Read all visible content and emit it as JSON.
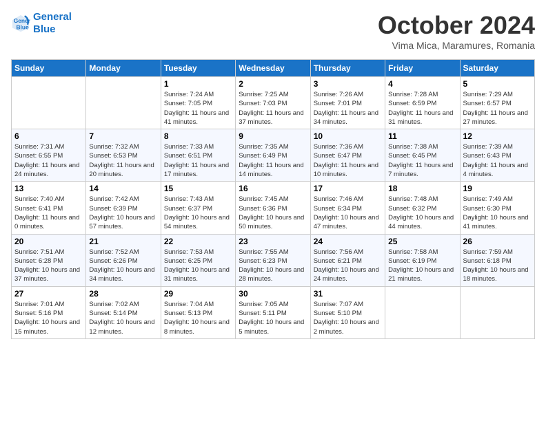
{
  "header": {
    "logo_line1": "General",
    "logo_line2": "Blue",
    "month": "October 2024",
    "location": "Vima Mica, Maramures, Romania"
  },
  "days_of_week": [
    "Sunday",
    "Monday",
    "Tuesday",
    "Wednesday",
    "Thursday",
    "Friday",
    "Saturday"
  ],
  "weeks": [
    [
      {
        "day": "",
        "info": ""
      },
      {
        "day": "",
        "info": ""
      },
      {
        "day": "1",
        "info": "Sunrise: 7:24 AM\nSunset: 7:05 PM\nDaylight: 11 hours and 41 minutes."
      },
      {
        "day": "2",
        "info": "Sunrise: 7:25 AM\nSunset: 7:03 PM\nDaylight: 11 hours and 37 minutes."
      },
      {
        "day": "3",
        "info": "Sunrise: 7:26 AM\nSunset: 7:01 PM\nDaylight: 11 hours and 34 minutes."
      },
      {
        "day": "4",
        "info": "Sunrise: 7:28 AM\nSunset: 6:59 PM\nDaylight: 11 hours and 31 minutes."
      },
      {
        "day": "5",
        "info": "Sunrise: 7:29 AM\nSunset: 6:57 PM\nDaylight: 11 hours and 27 minutes."
      }
    ],
    [
      {
        "day": "6",
        "info": "Sunrise: 7:31 AM\nSunset: 6:55 PM\nDaylight: 11 hours and 24 minutes."
      },
      {
        "day": "7",
        "info": "Sunrise: 7:32 AM\nSunset: 6:53 PM\nDaylight: 11 hours and 20 minutes."
      },
      {
        "day": "8",
        "info": "Sunrise: 7:33 AM\nSunset: 6:51 PM\nDaylight: 11 hours and 17 minutes."
      },
      {
        "day": "9",
        "info": "Sunrise: 7:35 AM\nSunset: 6:49 PM\nDaylight: 11 hours and 14 minutes."
      },
      {
        "day": "10",
        "info": "Sunrise: 7:36 AM\nSunset: 6:47 PM\nDaylight: 11 hours and 10 minutes."
      },
      {
        "day": "11",
        "info": "Sunrise: 7:38 AM\nSunset: 6:45 PM\nDaylight: 11 hours and 7 minutes."
      },
      {
        "day": "12",
        "info": "Sunrise: 7:39 AM\nSunset: 6:43 PM\nDaylight: 11 hours and 4 minutes."
      }
    ],
    [
      {
        "day": "13",
        "info": "Sunrise: 7:40 AM\nSunset: 6:41 PM\nDaylight: 11 hours and 0 minutes."
      },
      {
        "day": "14",
        "info": "Sunrise: 7:42 AM\nSunset: 6:39 PM\nDaylight: 10 hours and 57 minutes."
      },
      {
        "day": "15",
        "info": "Sunrise: 7:43 AM\nSunset: 6:37 PM\nDaylight: 10 hours and 54 minutes."
      },
      {
        "day": "16",
        "info": "Sunrise: 7:45 AM\nSunset: 6:36 PM\nDaylight: 10 hours and 50 minutes."
      },
      {
        "day": "17",
        "info": "Sunrise: 7:46 AM\nSunset: 6:34 PM\nDaylight: 10 hours and 47 minutes."
      },
      {
        "day": "18",
        "info": "Sunrise: 7:48 AM\nSunset: 6:32 PM\nDaylight: 10 hours and 44 minutes."
      },
      {
        "day": "19",
        "info": "Sunrise: 7:49 AM\nSunset: 6:30 PM\nDaylight: 10 hours and 41 minutes."
      }
    ],
    [
      {
        "day": "20",
        "info": "Sunrise: 7:51 AM\nSunset: 6:28 PM\nDaylight: 10 hours and 37 minutes."
      },
      {
        "day": "21",
        "info": "Sunrise: 7:52 AM\nSunset: 6:26 PM\nDaylight: 10 hours and 34 minutes."
      },
      {
        "day": "22",
        "info": "Sunrise: 7:53 AM\nSunset: 6:25 PM\nDaylight: 10 hours and 31 minutes."
      },
      {
        "day": "23",
        "info": "Sunrise: 7:55 AM\nSunset: 6:23 PM\nDaylight: 10 hours and 28 minutes."
      },
      {
        "day": "24",
        "info": "Sunrise: 7:56 AM\nSunset: 6:21 PM\nDaylight: 10 hours and 24 minutes."
      },
      {
        "day": "25",
        "info": "Sunrise: 7:58 AM\nSunset: 6:19 PM\nDaylight: 10 hours and 21 minutes."
      },
      {
        "day": "26",
        "info": "Sunrise: 7:59 AM\nSunset: 6:18 PM\nDaylight: 10 hours and 18 minutes."
      }
    ],
    [
      {
        "day": "27",
        "info": "Sunrise: 7:01 AM\nSunset: 5:16 PM\nDaylight: 10 hours and 15 minutes."
      },
      {
        "day": "28",
        "info": "Sunrise: 7:02 AM\nSunset: 5:14 PM\nDaylight: 10 hours and 12 minutes."
      },
      {
        "day": "29",
        "info": "Sunrise: 7:04 AM\nSunset: 5:13 PM\nDaylight: 10 hours and 8 minutes."
      },
      {
        "day": "30",
        "info": "Sunrise: 7:05 AM\nSunset: 5:11 PM\nDaylight: 10 hours and 5 minutes."
      },
      {
        "day": "31",
        "info": "Sunrise: 7:07 AM\nSunset: 5:10 PM\nDaylight: 10 hours and 2 minutes."
      },
      {
        "day": "",
        "info": ""
      },
      {
        "day": "",
        "info": ""
      }
    ]
  ]
}
